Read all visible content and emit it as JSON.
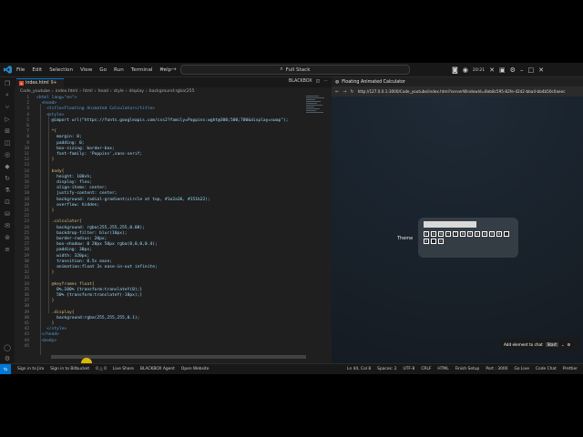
{
  "menu": [
    "File",
    "Edit",
    "Selection",
    "View",
    "Go",
    "Run",
    "Terminal",
    "Help"
  ],
  "search": {
    "text": "Full Stack"
  },
  "clock": "20:21",
  "editor": {
    "tab_name": "index.html",
    "tab_badge": "9+",
    "right_label": "BLACKBOX",
    "breadcrumb": [
      "Code_youtube",
      "index.html",
      "html",
      "head",
      "style",
      "display",
      "background:rgba(255"
    ],
    "code": [
      {
        "n": "1",
        "t": "<html lang=\"en\">"
      },
      {
        "n": "2",
        "t": "  <head>"
      },
      {
        "n": "3",
        "t": "    <title>Floating Animated Calculator</title>"
      },
      {
        "n": "4",
        "t": "    <style>"
      },
      {
        "n": "5",
        "t": "      @import url(\"https://fonts.googleapis.com/css2?family=Poppins:wght@300;500;700&display=swap\");"
      },
      {
        "n": "6",
        "t": ""
      },
      {
        "n": "7",
        "t": "      *{"
      },
      {
        "n": "8",
        "t": "        margin: 0;"
      },
      {
        "n": "9",
        "t": "        padding: 0;"
      },
      {
        "n": "10",
        "t": "        box-sizing: border-box;"
      },
      {
        "n": "11",
        "t": "        font-family: 'Poppins',sans-serif;"
      },
      {
        "n": "12",
        "t": "      }"
      },
      {
        "n": "13",
        "t": ""
      },
      {
        "n": "14",
        "t": "      body{"
      },
      {
        "n": "15",
        "t": "        height: 100vh;"
      },
      {
        "n": "16",
        "t": "        display: flex;"
      },
      {
        "n": "17",
        "t": "        align-items: center;"
      },
      {
        "n": "18",
        "t": "        justify-content: center;"
      },
      {
        "n": "19",
        "t": "        background: radial-gradient(circle at top, #1e2a36, #151b22);"
      },
      {
        "n": "20",
        "t": "        overflow: hidden;"
      },
      {
        "n": "21",
        "t": "      }"
      },
      {
        "n": "22",
        "t": ""
      },
      {
        "n": "23",
        "t": "      .calculator{"
      },
      {
        "n": "24",
        "t": "        background: rgba(255,255,255,0.08);"
      },
      {
        "n": "25",
        "t": "        backdrop-filter: blur(10px);"
      },
      {
        "n": "26",
        "t": "        border-radius: 20px;"
      },
      {
        "n": "27",
        "t": "        box-shadow: 0 20px 50px rgba(0,0,0,0.4);"
      },
      {
        "n": "28",
        "t": "        padding: 30px;"
      },
      {
        "n": "29",
        "t": "        width: 320px;"
      },
      {
        "n": "30",
        "t": "        transition: 0.5s ease;"
      },
      {
        "n": "31",
        "t": "        animation:float 3s ease-in-out infinite;"
      },
      {
        "n": "32",
        "t": "      }"
      },
      {
        "n": "33",
        "t": ""
      },
      {
        "n": "34",
        "t": "      @keyframes float{"
      },
      {
        "n": "35",
        "t": "        0%,100% {transform:translateY(0);}"
      },
      {
        "n": "36",
        "t": "        50% {transform:translateY(-10px);}"
      },
      {
        "n": "37",
        "t": "      }"
      },
      {
        "n": "38",
        "t": ""
      },
      {
        "n": "39",
        "t": "      .display{"
      },
      {
        "n": "40",
        "t": "        background:rgba(255,255,255,0.1);"
      },
      {
        "n": "41",
        "t": "      }"
      },
      {
        "n": "42",
        "t": "    </style>"
      },
      {
        "n": "43",
        "t": "  </head>"
      },
      {
        "n": "44",
        "t": "  <body>"
      },
      {
        "n": "45",
        "t": ""
      }
    ]
  },
  "browser": {
    "tab_title": "Floating Animated Calculator",
    "url": "http://127.0.0.1:3000/Code_youtube/index.html?serverWindowId=8eb8c595-82fe-42d2-bba4-bb4b50c0aeec",
    "theme_label": "Theme",
    "add_element": "Add element to chat",
    "start_label": "Start",
    "calc_rows": [
      [
        "C",
        "±",
        "%",
        "÷",
        "7",
        "8",
        "9",
        "×",
        "4",
        "5",
        "6",
        "-"
      ],
      [
        "0",
        ".",
        "="
      ]
    ]
  },
  "status": {
    "left": [
      "Sign in to Jira",
      "Sign in to Bitbucket",
      "0 △ 0",
      "Live Share",
      "BLACKBOX Agent",
      "Open Website"
    ],
    "right": [
      "Ln 44, Col 8",
      "Spaces: 2",
      "UTF-8",
      "CRLF",
      "HTML",
      "Finish Setup",
      "Port : 3000",
      "Go Live",
      "Code Chat",
      "Prettier"
    ]
  },
  "colors": {
    "accent": "#0078d4",
    "keyword": "#569cd6",
    "property": "#9cdcfe",
    "value": "#ce9178",
    "selector": "#d7ba7d"
  }
}
